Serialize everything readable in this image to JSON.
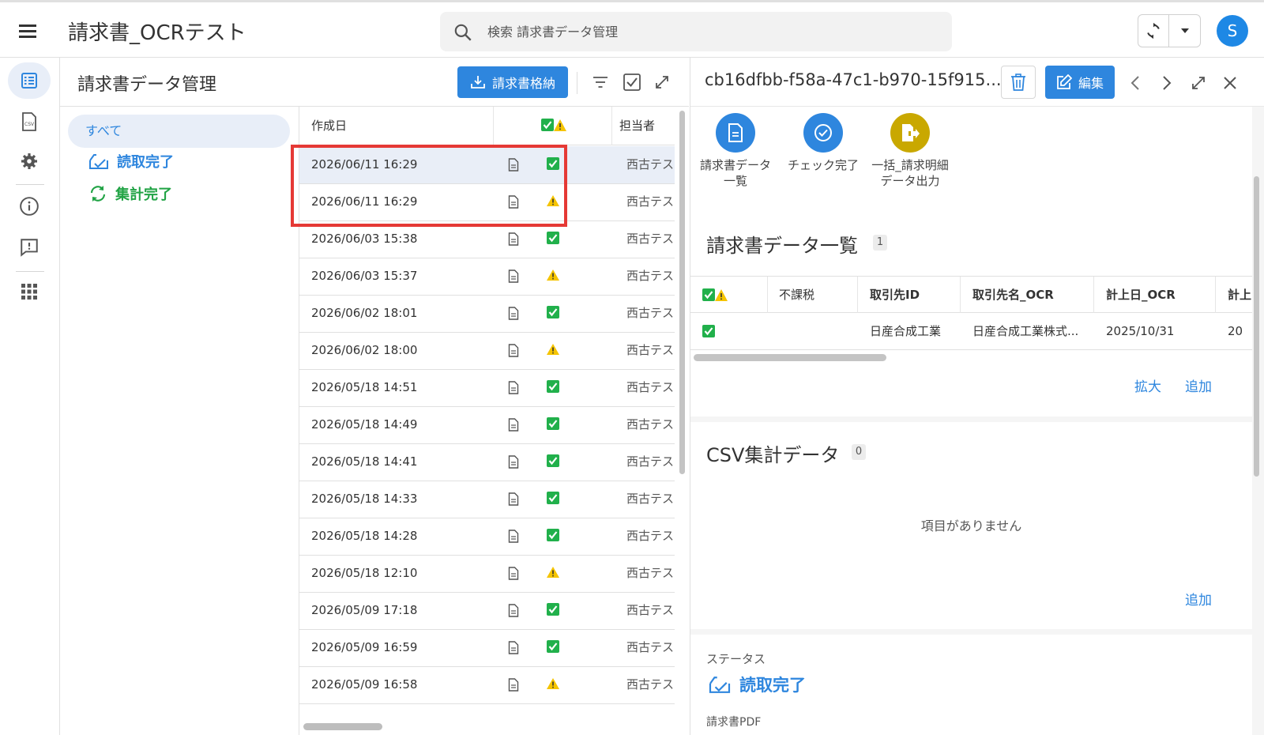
{
  "header": {
    "title": "請求書_OCRテスト",
    "search_placeholder": "検索 請求書データ管理",
    "avatar_letter": "S"
  },
  "panel": {
    "title": "請求書データ管理",
    "store_button": "請求書格納"
  },
  "status_nav": {
    "all": "すべて",
    "items": [
      {
        "label": "読取完了",
        "color": "#2e86de"
      },
      {
        "label": "集計完了",
        "color": "#21a345"
      }
    ]
  },
  "table": {
    "columns": [
      "作成日",
      "担当者"
    ],
    "rows": [
      {
        "date": "2026/06/11 16:29",
        "status": "ok",
        "person": "西古テス"
      },
      {
        "date": "2026/06/11 16:29",
        "status": "warn",
        "person": "西古テス"
      },
      {
        "date": "2026/06/03 15:38",
        "status": "ok",
        "person": "西古テス"
      },
      {
        "date": "2026/06/03 15:37",
        "status": "warn",
        "person": "西古テス"
      },
      {
        "date": "2026/06/02 18:01",
        "status": "ok",
        "person": "西古テス"
      },
      {
        "date": "2026/06/02 18:00",
        "status": "warn",
        "person": "西古テス"
      },
      {
        "date": "2026/05/18 14:51",
        "status": "ok",
        "person": "西古テス"
      },
      {
        "date": "2026/05/18 14:49",
        "status": "ok",
        "person": "西古テス"
      },
      {
        "date": "2026/05/18 14:41",
        "status": "ok",
        "person": "西古テス"
      },
      {
        "date": "2026/05/18 14:33",
        "status": "ok",
        "person": "西古テス"
      },
      {
        "date": "2026/05/18 14:28",
        "status": "ok",
        "person": "西古テス"
      },
      {
        "date": "2026/05/18 12:10",
        "status": "warn",
        "person": "西古テス"
      },
      {
        "date": "2026/05/09 17:18",
        "status": "ok",
        "person": "西古テス"
      },
      {
        "date": "2026/05/09 16:59",
        "status": "ok",
        "person": "西古テス"
      },
      {
        "date": "2026/05/09 16:58",
        "status": "warn",
        "person": "西古テス"
      }
    ]
  },
  "detail": {
    "id": "cb16dfbb-f58a-47c1-b970-15f915...",
    "edit_button": "編集",
    "actions": [
      {
        "label1": "請求書データ",
        "label2": "一覧",
        "color": "#2e86de"
      },
      {
        "label1": "チェック完了",
        "label2": "",
        "color": "#2e86de"
      },
      {
        "label1": "一括_請求明細",
        "label2": "データ出力",
        "color": "#c9a800"
      }
    ],
    "invoice_list": {
      "title": "請求書データ一覧",
      "count": "1",
      "columns": [
        "不課税",
        "取引先ID",
        "取引先名_OCR",
        "計上日_OCR",
        "計上"
      ],
      "row": {
        "tax": "",
        "partner_id": "日産合成工業",
        "partner_name": "日産合成工業株式...",
        "date": "2025/10/31",
        "next": "20"
      },
      "expand_link": "拡大",
      "add_link": "追加"
    },
    "csv": {
      "title": "CSV集計データ",
      "count": "0",
      "empty": "項目がありません",
      "add_link": "追加"
    },
    "status": {
      "label": "ステータス",
      "value": "読取完了",
      "pdf_label": "請求書PDF"
    }
  },
  "colors": {
    "accent": "#2e86de",
    "ok_green": "#21b04b",
    "warn_yellow": "#f5c400",
    "highlight_red": "#e53935"
  }
}
